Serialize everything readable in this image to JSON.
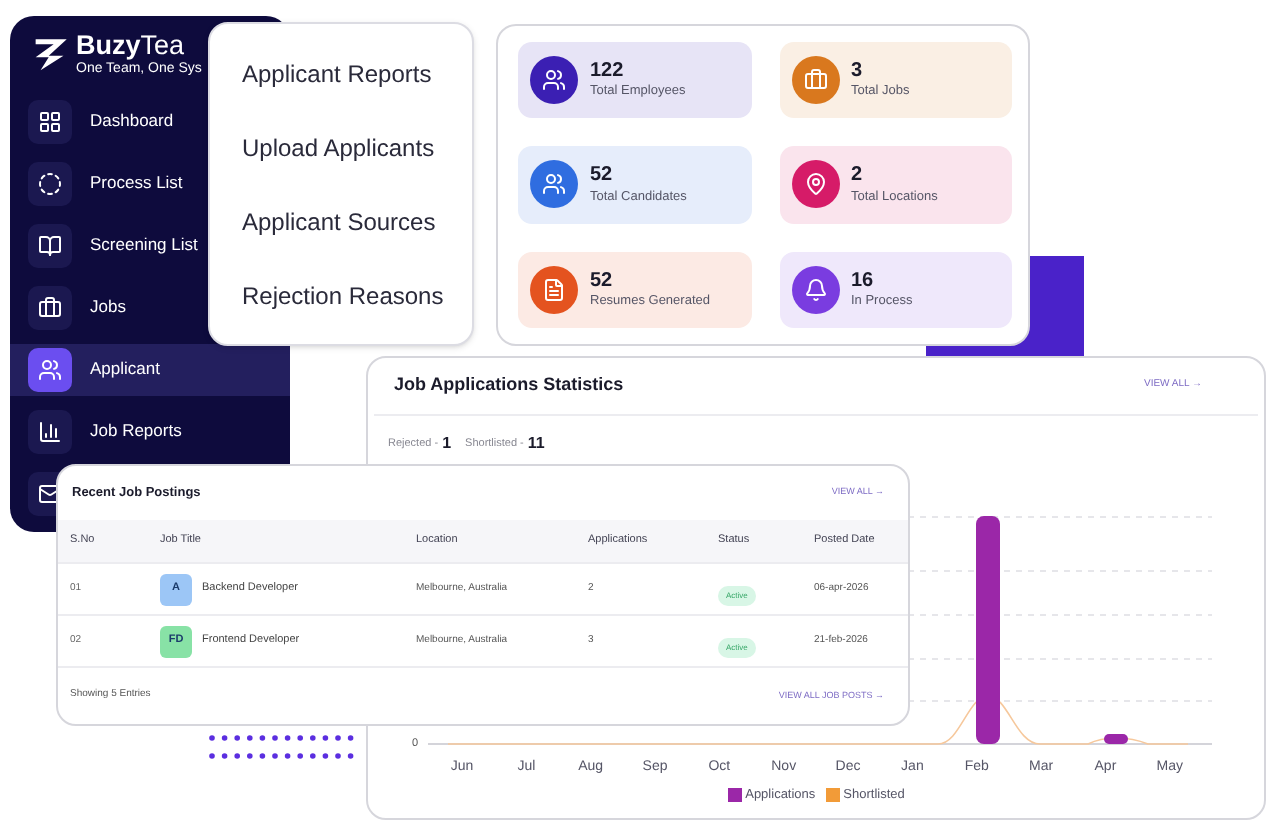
{
  "sidebar": {
    "logo": "**Buzy**Tea",
    "tagline": "One Team, One Sys",
    "items": [
      {
        "label": "Dashboard",
        "kind": "grid",
        "selected": false
      },
      {
        "label": "Process List",
        "kind": "process",
        "selected": false
      },
      {
        "label": "Screening List",
        "kind": "book",
        "selected": false
      },
      {
        "label": "Jobs",
        "kind": "briefcase",
        "selected": false
      },
      {
        "label": "Applicant",
        "kind": "people",
        "selected": true
      },
      {
        "label": "Job Reports",
        "kind": "reports",
        "selected": false
      }
    ]
  },
  "menu": {
    "items": [
      "Applicant Reports",
      "Upload Applicants",
      "Applicant Sources",
      "Rejection Reasons"
    ]
  },
  "stats": [
    {
      "value": "122",
      "label": "Total Employees",
      "kind": "users",
      "color": "#3b1fb3"
    },
    {
      "value": "3",
      "label": "Total Jobs",
      "kind": "briefcase",
      "color": "#d9781e"
    },
    {
      "value": "52",
      "label": "Total Candidates",
      "kind": "users",
      "color": "#2f6de0"
    },
    {
      "value": "2",
      "label": "Total Locations",
      "kind": "location",
      "color": "#d61b68"
    },
    {
      "value": "52",
      "label": "Resumes Generated",
      "kind": "file",
      "color": "#e4531f"
    },
    {
      "value": "16",
      "label": "In Process",
      "kind": "bell",
      "color": "#7a3ce0"
    }
  ],
  "chart": {
    "title": "Job Applications Statistics",
    "view_all": "VIEW ALL →",
    "summary": [
      {
        "label": "Rejected -",
        "value": "1"
      },
      {
        "label": "Shortlisted -",
        "value": "11"
      }
    ],
    "y_tick": "0",
    "months": [
      "Jun",
      "Jul",
      "Aug",
      "Sep",
      "Oct",
      "Nov",
      "Dec",
      "Jan",
      "Feb",
      "Mar",
      "Apr",
      "May"
    ],
    "legend": [
      {
        "label": "Applications",
        "color": "#9b27a8"
      },
      {
        "label": "Shortlisted",
        "color": "#f29b38"
      }
    ]
  },
  "table": {
    "title": "Recent Job Postings",
    "view_all": "VIEW ALL →",
    "columns": [
      "S.No",
      "Job Title",
      "Location",
      "Applications",
      "Status",
      "Posted Date"
    ],
    "rows": [
      {
        "sno": "01",
        "initials": "A",
        "color": "#9cc6f6",
        "title": "Backend Developer",
        "location": "Melbourne, Australia",
        "applications": "2",
        "status": "Active",
        "date": "06-apr-2026"
      },
      {
        "sno": "02",
        "initials": "FD",
        "color": "#88e2a6",
        "title": "Frontend Developer",
        "location": "Melbourne, Australia",
        "applications": "3",
        "status": "Active",
        "date": "21-feb-2026"
      }
    ],
    "footer": "Showing 5 Entries",
    "view_all_posts": "VIEW ALL JOB POSTS →"
  }
}
